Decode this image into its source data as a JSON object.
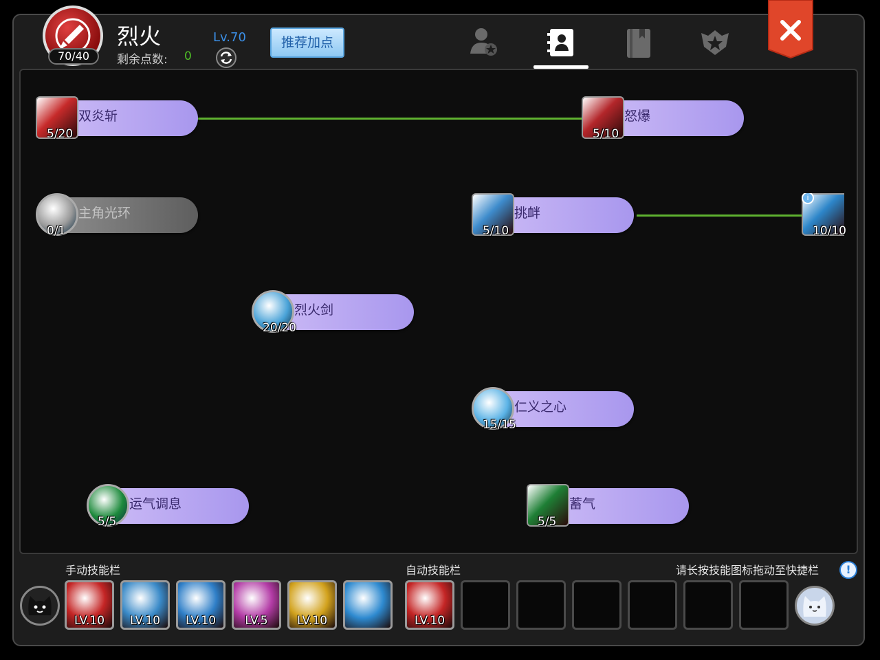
{
  "header": {
    "emblem_count": "70/40",
    "character_name": "烈火",
    "remaining_points_label": "剩余点数:",
    "remaining_points_value": "0",
    "level": "Lv.70",
    "recommend_button": "推荐加点",
    "tabs": [
      {
        "icon": "profile-star-icon"
      },
      {
        "icon": "contacts-book-icon",
        "active": true
      },
      {
        "icon": "book-icon"
      },
      {
        "icon": "crest-icon"
      }
    ],
    "close_icon": "close-icon"
  },
  "skills": [
    {
      "name": "双炎斩",
      "level": "5/20",
      "color": "#c62a2a",
      "shape": "square"
    },
    {
      "name": "怒爆",
      "level": "5/10",
      "color": "#b3262a",
      "shape": "square"
    },
    {
      "name": "主角光环",
      "level": "0/1",
      "color": "#9a9a9a",
      "shape": "round",
      "locked": true
    },
    {
      "name": "挑衅",
      "level": "5/10",
      "color": "#3e8ccc",
      "shape": "square"
    },
    {
      "name": "",
      "level": "10/10",
      "color": "#2d86c9",
      "shape": "square",
      "partial": true
    },
    {
      "name": "烈火剑",
      "level": "20/20",
      "color": "#4aa3d8",
      "shape": "round"
    },
    {
      "name": "仁义之心",
      "level": "15/15",
      "color": "#5bb3e6",
      "shape": "round"
    },
    {
      "name": "运气调息",
      "level": "5/5",
      "color": "#1d8a3c",
      "shape": "round"
    },
    {
      "name": "蓄气",
      "level": "5/5",
      "color": "#1e7f35",
      "shape": "square"
    }
  ],
  "bottom": {
    "manual_label": "手动技能栏",
    "auto_label": "自动技能栏",
    "hint": "请长按技能图标拖动至快捷栏",
    "manual_slots": [
      {
        "level": "LV.10",
        "color": "#c42525"
      },
      {
        "level": "LV.10",
        "color": "#3a8ac8"
      },
      {
        "level": "LV.10",
        "color": "#2f7fc8"
      },
      {
        "level": "LV.5",
        "color": "#b33ca6"
      },
      {
        "level": "LV.10",
        "color": "#d2a21d"
      },
      {
        "level": "",
        "color": "#2e8ad0"
      }
    ],
    "auto_slots": [
      {
        "level": "LV.10",
        "color": "#c42525"
      },
      {
        "level": ""
      },
      {
        "level": ""
      },
      {
        "level": ""
      },
      {
        "level": ""
      },
      {
        "level": ""
      },
      {
        "level": ""
      }
    ]
  }
}
